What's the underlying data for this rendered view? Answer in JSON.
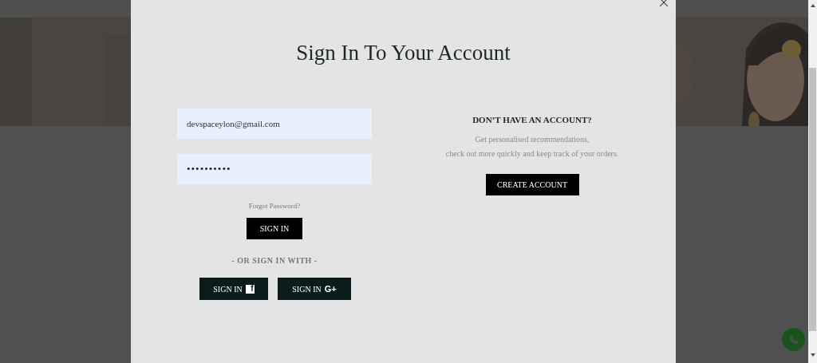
{
  "modal": {
    "title": "Sign In To Your Account",
    "sign_in": {
      "email": {
        "value": "devspaceylon@gmail.com"
      },
      "password": {
        "value": "••••••••••"
      },
      "forgot_link": "Forgot Password?",
      "button": "SIGN IN",
      "divider": "- OR SIGN IN WITH -",
      "social_buttons": [
        {
          "kind": "facebook",
          "label": "SIGN IN",
          "glyph": "f"
        },
        {
          "kind": "google",
          "label": "SIGN IN",
          "glyph": "G+"
        }
      ]
    },
    "register": {
      "heading": "DON’T HAVE AN ACCOUNT?",
      "text_lines": [
        "Get personalised recommendations,",
        "check out more quickly and keep track of your orders."
      ],
      "button": "CREATE ACCOUNT"
    }
  }
}
